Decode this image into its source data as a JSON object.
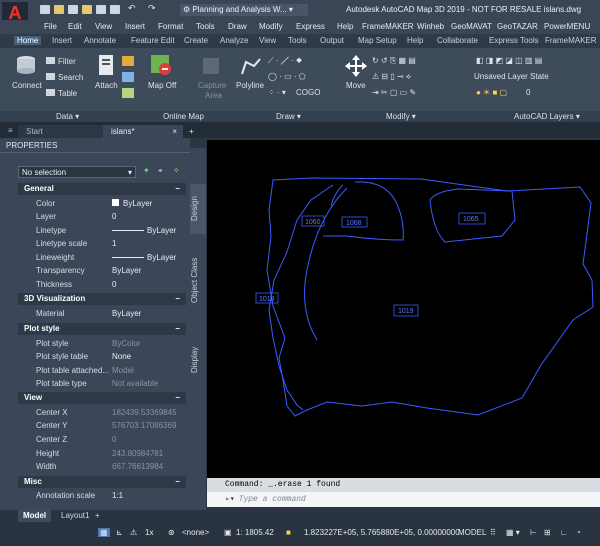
{
  "app": {
    "logo_text": "A",
    "workspace": "Planning and Analysis W...",
    "title": "Autodesk AutoCAD Map 3D 2019 - NOT FOR RESALE   islans.dwg"
  },
  "menu": [
    "File",
    "Edit",
    "View",
    "Insert",
    "Format",
    "Tools",
    "Draw",
    "Modify",
    "Express",
    "Help",
    "FrameMAKER",
    "Winheb",
    "GeoMAVAT",
    "GeoTAZAR",
    "PowerMENU"
  ],
  "tabs": [
    "Home",
    "Insert",
    "Annotate",
    "Feature Edit",
    "Create",
    "Analyze",
    "View",
    "Tools",
    "Output",
    "Map Setup",
    "Help",
    "Collaborate",
    "Express Tools",
    "FrameMAKER"
  ],
  "ribbon": {
    "connect": "Connect",
    "filter": "Filter",
    "search": "Search",
    "table": "Table",
    "attach": "Attach",
    "map_off": "Map Off",
    "capture_area_1": "Capture",
    "capture_area_2": "Area",
    "polyline": "Polyline",
    "cogo": "COGO",
    "move": "Move",
    "layer_state": "Unsaved Layer State",
    "layer_num": "0"
  },
  "panels": [
    "Data",
    "Online Map",
    "Draw",
    "Modify",
    "AutoCAD Layers"
  ],
  "doctabs": {
    "start": "Start",
    "drawing": "islans*"
  },
  "properties": {
    "title": "PROPERTIES",
    "selection": "No selection",
    "sections": {
      "general": "General",
      "viz": "3D Visualization",
      "plot": "Plot style",
      "view": "View",
      "misc": "Misc"
    },
    "general": [
      {
        "label": "Color",
        "value": "ByLayer"
      },
      {
        "label": "Layer",
        "value": "0"
      },
      {
        "label": "Linetype",
        "value": "ByLayer"
      },
      {
        "label": "Linetype scale",
        "value": "1"
      },
      {
        "label": "Lineweight",
        "value": "ByLayer"
      },
      {
        "label": "Transparency",
        "value": "ByLayer"
      },
      {
        "label": "Thickness",
        "value": "0"
      }
    ],
    "viz": [
      {
        "label": "Material",
        "value": "ByLayer"
      }
    ],
    "plot": [
      {
        "label": "Plot style",
        "value": "ByColor"
      },
      {
        "label": "Plot style table",
        "value": "None"
      },
      {
        "label": "Plot table attached...",
        "value": "Model"
      },
      {
        "label": "Plot table type",
        "value": "Not available"
      }
    ],
    "view": [
      {
        "label": "Center X",
        "value": "182439.53369845"
      },
      {
        "label": "Center Y",
        "value": "576703.17086369"
      },
      {
        "label": "Center Z",
        "value": "0"
      },
      {
        "label": "Height",
        "value": "243.80984781"
      },
      {
        "label": "Width",
        "value": "667.76613984"
      }
    ],
    "misc": [
      {
        "label": "Annotation scale",
        "value": "1:1"
      }
    ]
  },
  "vtabs": [
    "Design",
    "Object Class",
    "Display"
  ],
  "drawing": {
    "labels": [
      "1060",
      "1068",
      "1065",
      "1018",
      "1019"
    ],
    "line_color": "#3a5bff"
  },
  "command": {
    "history": "Command: _.erase 1 found",
    "placeholder": "Type a command"
  },
  "layout_tabs": [
    "Model",
    "Layout1"
  ],
  "status": {
    "annot": "1x",
    "viewport": "<none>",
    "scale": "1: 1805.42",
    "coords": "1.823227E+05, 5.765880E+05, 0.00000000",
    "space": "MODEL"
  }
}
